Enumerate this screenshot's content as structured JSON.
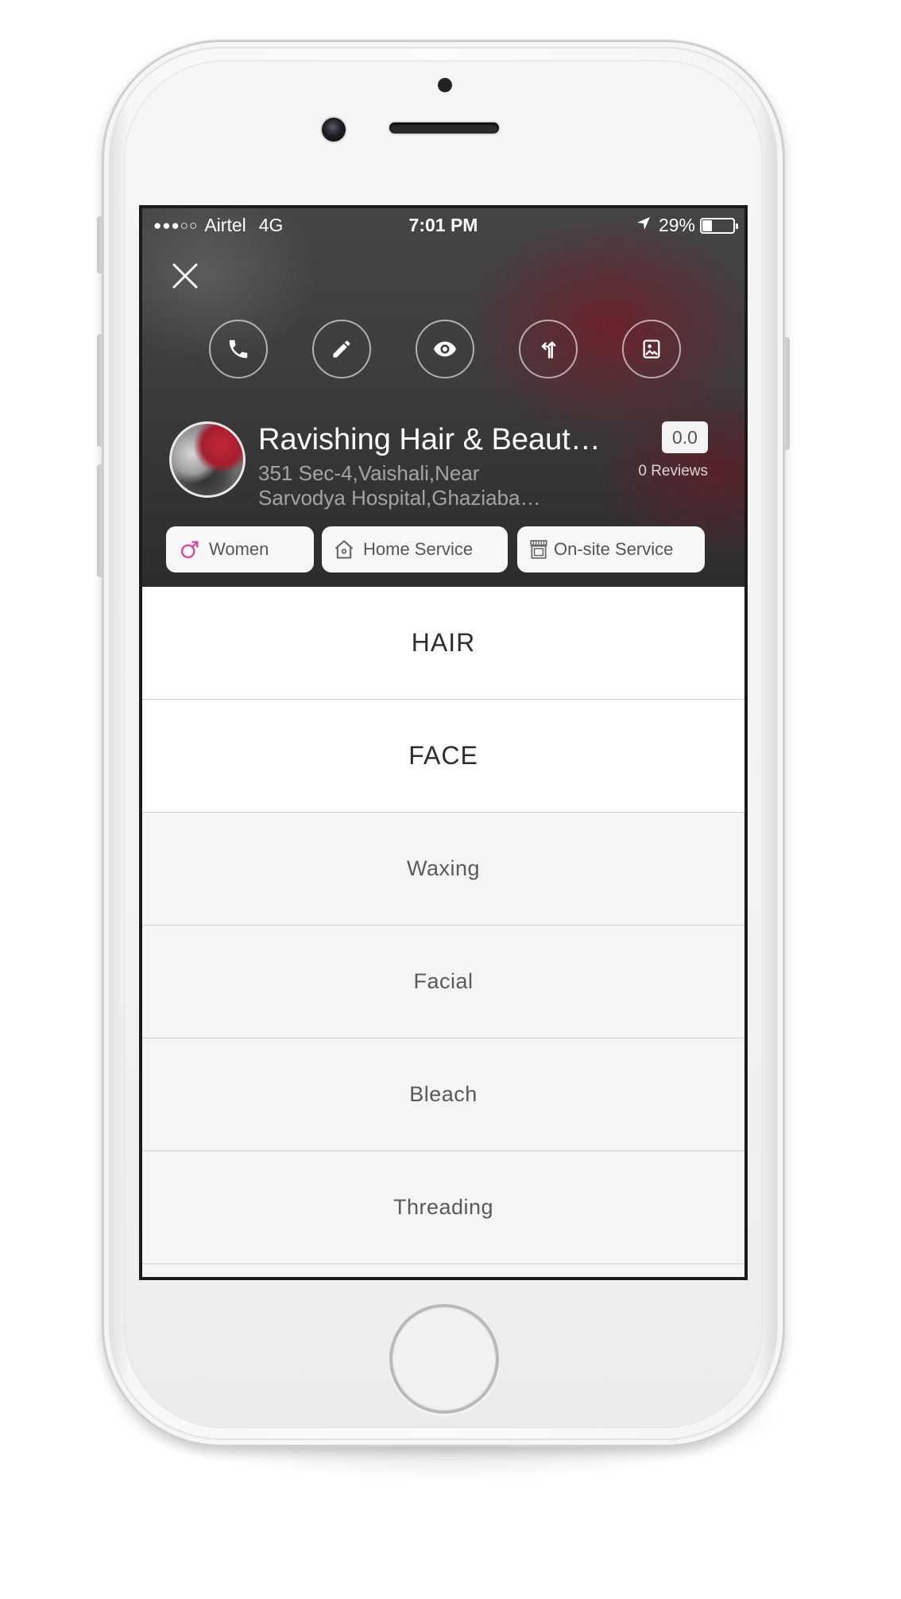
{
  "status_bar": {
    "signal": "●●●○○",
    "carrier": "Airtel",
    "network": "4G",
    "time": "7:01 PM",
    "battery_text": "29%",
    "battery_level": 0.29
  },
  "actions": [
    {
      "icon": "phone-icon"
    },
    {
      "icon": "pencil-icon"
    },
    {
      "icon": "eye-icon"
    },
    {
      "icon": "directions-icon"
    },
    {
      "icon": "gallery-icon"
    }
  ],
  "salon": {
    "name": "Ravishing Hair & Beaut…",
    "address_line1": "351 Sec-4,Vaishali,Near",
    "address_line2": "Sarvodya Hospital,Ghaziaba…",
    "rating": "0.0",
    "reviews": "0 Reviews"
  },
  "chips": {
    "gender": "Women",
    "home_service": "Home Service",
    "onsite_service": "On-site Service"
  },
  "menu": {
    "hair": "HAIR",
    "face": "FACE",
    "waxing": "Waxing",
    "facial": "Facial",
    "bleach": "Bleach",
    "threading": "Threading"
  },
  "colors": {
    "gender_icon": "#e0409a",
    "accent_red": "#9c1e30"
  }
}
